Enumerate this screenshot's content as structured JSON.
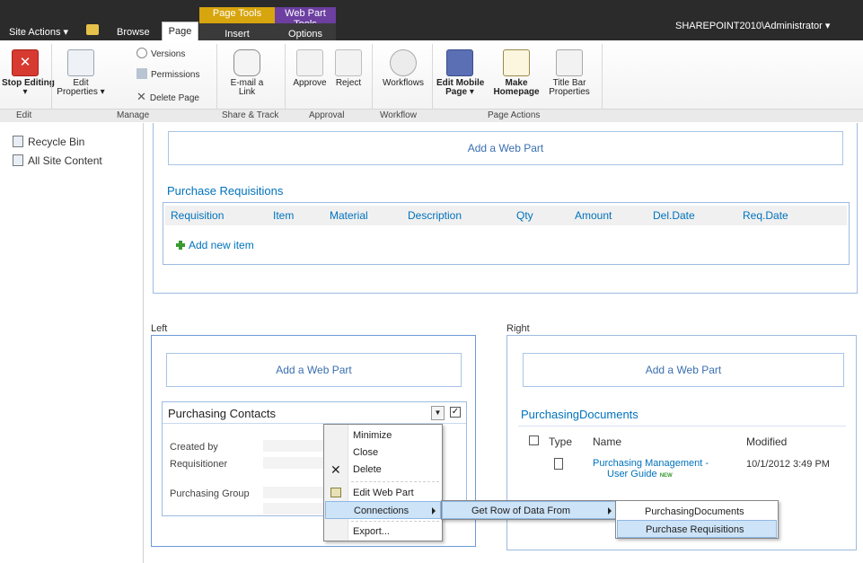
{
  "topbar": {
    "site_actions": "Site Actions",
    "browse_tab": "Browse",
    "page_tab": "Page",
    "page_tools_label": "Page Tools",
    "insert_tab": "Insert",
    "web_part_tools_label": "Web Part Tools",
    "options_tab": "Options",
    "user": "SHAREPOINT2010\\Administrator",
    "colors": {
      "page_tools": "#d7a50d",
      "web_part_tools": "#6c3fa0"
    }
  },
  "ribbon": {
    "stop_editing": "Stop Editing",
    "edit_properties_1": "Edit",
    "edit_properties_2": "Properties",
    "versions": "Versions",
    "permissions": "Permissions",
    "delete_page": "Delete Page",
    "email_link_1": "E-mail a",
    "email_link_2": "Link",
    "approve": "Approve",
    "reject": "Reject",
    "workflows": "Workflows",
    "edit_mobile_1": "Edit Mobile",
    "edit_mobile_2": "Page",
    "make_homepage_1": "Make",
    "make_homepage_2": "Homepage",
    "title_bar_1": "Title Bar",
    "title_bar_2": "Properties",
    "groups": {
      "edit": "Edit",
      "manage": "Manage",
      "share": "Share & Track",
      "approval": "Approval",
      "workflow": "Workflow",
      "page_actions": "Page Actions"
    }
  },
  "leftnav": {
    "recycle_bin": "Recycle Bin",
    "all_site_content": "All Site Content"
  },
  "main": {
    "add_web_part": "Add a Web Part",
    "purchase_requisitions": {
      "title": "Purchase Requisitions",
      "columns": [
        "Requisition",
        "Item",
        "Material",
        "Description",
        "Qty",
        "Amount",
        "Del.Date",
        "Req.Date"
      ],
      "add_new_item": "Add new item"
    },
    "left_zone_label": "Left",
    "right_zone_label": "Right",
    "purchasing_contacts": {
      "title": "Purchasing Contacts",
      "fields": [
        "Created by",
        "Requisitioner",
        "Purchasing Group"
      ]
    },
    "purchasing_documents": {
      "title": "PurchasingDocuments",
      "col_type": "Type",
      "col_name": "Name",
      "col_modified": "Modified",
      "doc_name_1": "Purchasing Management -",
      "doc_name_2": "User Guide",
      "new_badge": "NEW",
      "doc_modified": "10/1/2012 3:49 PM"
    }
  },
  "context_menu": {
    "minimize": "Minimize",
    "close": "Close",
    "delete": "Delete",
    "edit_web_part": "Edit Web Part",
    "connections": "Connections",
    "export": "Export..."
  },
  "submenu": {
    "get_row": "Get Row of Data From"
  },
  "subsubmenu": {
    "purchasing_documents": "PurchasingDocuments",
    "purchase_requisitions": "Purchase Requisitions"
  }
}
